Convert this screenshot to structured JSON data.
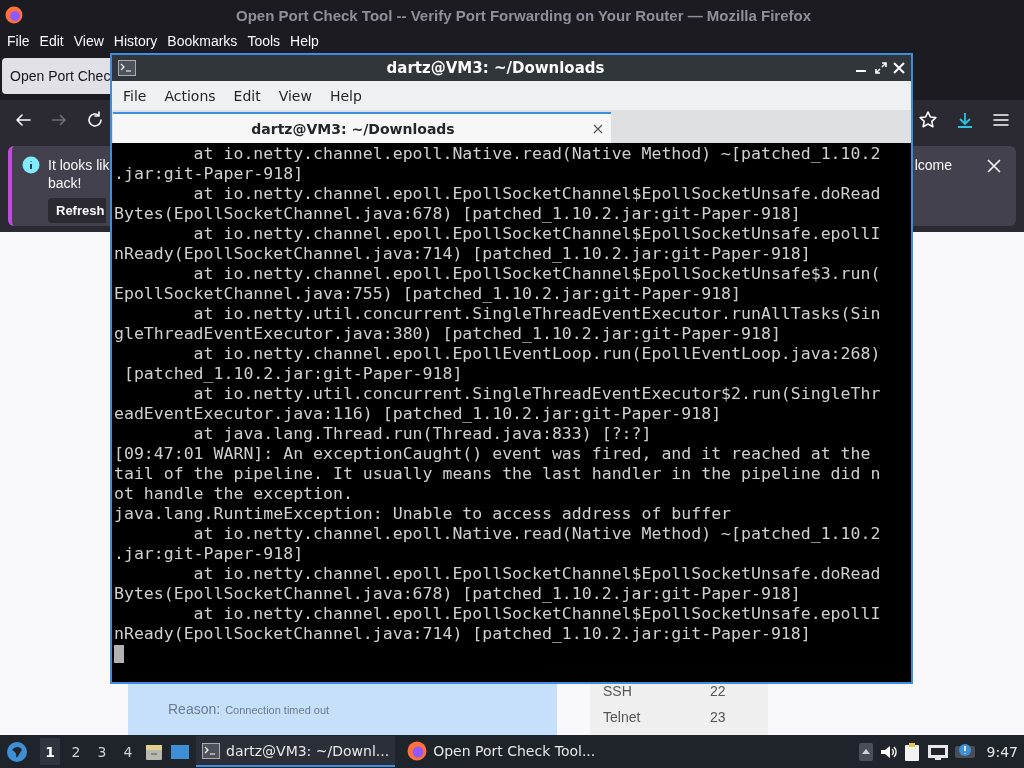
{
  "browser": {
    "title": "Open Port Check Tool -- Verify Port Forwarding on Your Router — Mozilla Firefox",
    "menu": [
      "File",
      "Edit",
      "View",
      "History",
      "Bookmarks",
      "Tools",
      "Help"
    ],
    "tabs": [
      {
        "label": "Open Port Chec",
        "selected": true
      }
    ],
    "notification": {
      "text_start": "It looks lik",
      "text_end": "lcome",
      "text_line2": "back!",
      "button": "Refresh"
    },
    "page": {
      "result": {
        "reason_label": "Reason:",
        "reason": "Connection timed out"
      },
      "ports": [
        {
          "service": "SSH",
          "port": "22"
        },
        {
          "service": "Telnet",
          "port": "23"
        }
      ]
    }
  },
  "terminal": {
    "title": "dartz@VM3: ~/Downloads",
    "menu": [
      "File",
      "Actions",
      "Edit",
      "View",
      "Help"
    ],
    "tab": "dartz@VM3: ~/Downloads",
    "lines": [
      "        at io.netty.channel.epoll.Native.read(Native Method) ~[patched_1.10.2",
      ".jar:git-Paper-918]",
      "        at io.netty.channel.epoll.EpollSocketChannel$EpollSocketUnsafe.doRead",
      "Bytes(EpollSocketChannel.java:678) [patched_1.10.2.jar:git-Paper-918]",
      "        at io.netty.channel.epoll.EpollSocketChannel$EpollSocketUnsafe.epollI",
      "nReady(EpollSocketChannel.java:714) [patched_1.10.2.jar:git-Paper-918]",
      "        at io.netty.channel.epoll.EpollSocketChannel$EpollSocketUnsafe$3.run(",
      "EpollSocketChannel.java:755) [patched_1.10.2.jar:git-Paper-918]",
      "        at io.netty.util.concurrent.SingleThreadEventExecutor.runAllTasks(Sin",
      "gleThreadEventExecutor.java:380) [patched_1.10.2.jar:git-Paper-918]",
      "        at io.netty.channel.epoll.EpollEventLoop.run(EpollEventLoop.java:268)",
      " [patched_1.10.2.jar:git-Paper-918]",
      "        at io.netty.util.concurrent.SingleThreadEventExecutor$2.run(SingleThr",
      "eadEventExecutor.java:116) [patched_1.10.2.jar:git-Paper-918]",
      "        at java.lang.Thread.run(Thread.java:833) [?:?]",
      "[09:47:01 WARN]: An exceptionCaught() event was fired, and it reached at the",
      "tail of the pipeline. It usually means the last handler in the pipeline did n",
      "ot handle the exception.",
      "java.lang.RuntimeException: Unable to access address of buffer",
      "        at io.netty.channel.epoll.Native.read(Native Method) ~[patched_1.10.2",
      ".jar:git-Paper-918]",
      "        at io.netty.channel.epoll.EpollSocketChannel$EpollSocketUnsafe.doRead",
      "Bytes(EpollSocketChannel.java:678) [patched_1.10.2.jar:git-Paper-918]",
      "        at io.netty.channel.epoll.EpollSocketChannel$EpollSocketUnsafe.epollI",
      "nReady(EpollSocketChannel.java:714) [patched_1.10.2.jar:git-Paper-918]"
    ]
  },
  "taskbar": {
    "workspaces": [
      {
        "label": "1",
        "selected": true
      },
      {
        "label": "2",
        "selected": false
      },
      {
        "label": "3",
        "selected": false
      },
      {
        "label": "4",
        "selected": false
      }
    ],
    "tasks": [
      {
        "kind": "terminal",
        "label": "dartz@VM3: ~/Downl...",
        "selected": true
      },
      {
        "kind": "browser",
        "label": "Open Port Check Tool...",
        "selected": false
      }
    ],
    "clock": "9:47"
  }
}
